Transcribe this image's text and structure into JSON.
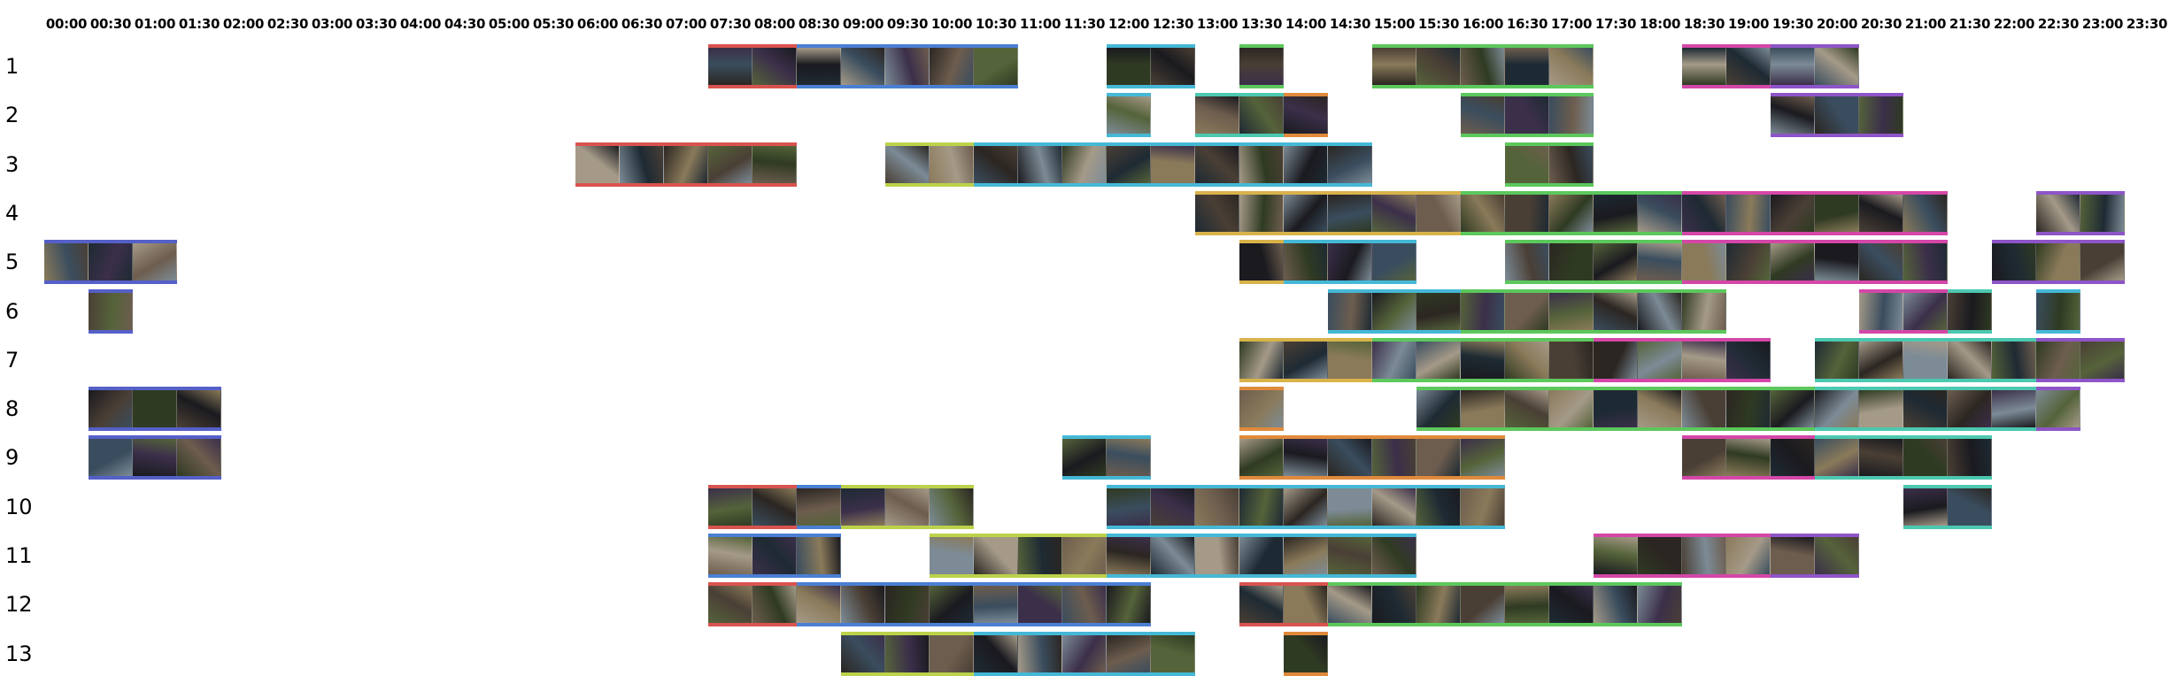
{
  "time_labels": [
    "00:00",
    "00:30",
    "01:00",
    "01:30",
    "02:00",
    "02:30",
    "03:00",
    "03:30",
    "04:00",
    "04:30",
    "05:00",
    "05:30",
    "06:00",
    "06:30",
    "07:00",
    "07:30",
    "08:00",
    "08:30",
    "09:00",
    "09:30",
    "10:00",
    "10:30",
    "11:00",
    "11:30",
    "12:00",
    "12:30",
    "13:00",
    "13:30",
    "14:00",
    "14:30",
    "15:00",
    "15:30",
    "16:00",
    "16:30",
    "17:00",
    "17:30",
    "18:00",
    "18:30",
    "19:00",
    "19:30",
    "20:00",
    "20:30",
    "21:00",
    "21:30",
    "22:00",
    "22:30",
    "23:00",
    "23:30"
  ],
  "bar_colors": {
    "red": "#d9534f",
    "blue": "#4a7fd4",
    "cyan": "#45b8d6",
    "green": "#5cc85c",
    "olive": "#bcd24a",
    "orange": "#e08a3c",
    "magenta": "#d447a8",
    "purple": "#8e55c8",
    "indigo": "#5560c8",
    "teal": "#4cc8b0",
    "gold": "#d8b34a"
  },
  "thumbnail_palette": [
    "#2b2622",
    "#4a3f35",
    "#6d5d4e",
    "#1e2a33",
    "#3a4d5e",
    "#7c8b96",
    "#2f3a22",
    "#55633a",
    "#8a7a5a",
    "#3b2f4a",
    "#a59a88",
    "#1a1a1f"
  ],
  "rows": [
    {
      "label": "1",
      "segments": [
        {
          "start": "07:30",
          "end": "08:30",
          "color": "red"
        },
        {
          "start": "08:30",
          "end": "11:00",
          "color": "blue"
        },
        {
          "start": "12:00",
          "end": "13:00",
          "color": "cyan"
        },
        {
          "start": "13:30",
          "end": "14:00",
          "color": "green"
        },
        {
          "start": "15:00",
          "end": "16:30",
          "color": "green"
        },
        {
          "start": "16:30",
          "end": "17:30",
          "color": "green"
        },
        {
          "start": "18:30",
          "end": "19:30",
          "color": "magenta"
        },
        {
          "start": "19:30",
          "end": "20:30",
          "color": "purple"
        }
      ]
    },
    {
      "label": "2",
      "segments": [
        {
          "start": "12:00",
          "end": "12:30",
          "color": "cyan"
        },
        {
          "start": "13:00",
          "end": "14:00",
          "color": "teal"
        },
        {
          "start": "14:00",
          "end": "14:30",
          "color": "orange"
        },
        {
          "start": "16:00",
          "end": "17:30",
          "color": "green"
        },
        {
          "start": "19:30",
          "end": "21:00",
          "color": "purple"
        }
      ]
    },
    {
      "label": "3",
      "segments": [
        {
          "start": "06:00",
          "end": "08:30",
          "color": "red"
        },
        {
          "start": "09:30",
          "end": "10:30",
          "color": "olive"
        },
        {
          "start": "10:30",
          "end": "15:00",
          "color": "cyan"
        },
        {
          "start": "16:30",
          "end": "17:30",
          "color": "green"
        }
      ]
    },
    {
      "label": "4",
      "segments": [
        {
          "start": "13:00",
          "end": "16:00",
          "color": "gold"
        },
        {
          "start": "16:00",
          "end": "18:30",
          "color": "green"
        },
        {
          "start": "18:30",
          "end": "21:30",
          "color": "magenta"
        },
        {
          "start": "22:30",
          "end": "23:30",
          "color": "purple"
        }
      ]
    },
    {
      "label": "5",
      "segments": [
        {
          "start": "00:00",
          "end": "01:30",
          "color": "indigo"
        },
        {
          "start": "13:30",
          "end": "14:00",
          "color": "gold"
        },
        {
          "start": "14:00",
          "end": "15:30",
          "color": "cyan"
        },
        {
          "start": "16:30",
          "end": "18:30",
          "color": "green"
        },
        {
          "start": "18:30",
          "end": "21:30",
          "color": "magenta"
        },
        {
          "start": "22:00",
          "end": "23:30",
          "color": "purple"
        }
      ]
    },
    {
      "label": "6",
      "segments": [
        {
          "start": "00:30",
          "end": "01:00",
          "color": "indigo"
        },
        {
          "start": "14:30",
          "end": "16:00",
          "color": "cyan"
        },
        {
          "start": "16:00",
          "end": "19:00",
          "color": "green"
        },
        {
          "start": "20:30",
          "end": "21:30",
          "color": "magenta"
        },
        {
          "start": "21:30",
          "end": "22:00",
          "color": "teal"
        },
        {
          "start": "22:30",
          "end": "23:00",
          "color": "cyan"
        }
      ]
    },
    {
      "label": "7",
      "segments": [
        {
          "start": "13:30",
          "end": "15:00",
          "color": "gold"
        },
        {
          "start": "15:00",
          "end": "17:30",
          "color": "green"
        },
        {
          "start": "17:30",
          "end": "19:30",
          "color": "magenta"
        },
        {
          "start": "20:00",
          "end": "22:30",
          "color": "teal"
        },
        {
          "start": "22:30",
          "end": "23:30",
          "color": "purple"
        }
      ]
    },
    {
      "label": "8",
      "segments": [
        {
          "start": "00:30",
          "end": "02:00",
          "color": "indigo"
        },
        {
          "start": "13:30",
          "end": "14:00",
          "color": "orange"
        },
        {
          "start": "15:30",
          "end": "17:00",
          "color": "green"
        },
        {
          "start": "17:00",
          "end": "20:00",
          "color": "green"
        },
        {
          "start": "20:00",
          "end": "21:30",
          "color": "teal"
        },
        {
          "start": "21:30",
          "end": "22:30",
          "color": "teal"
        },
        {
          "start": "22:30",
          "end": "23:00",
          "color": "purple"
        }
      ]
    },
    {
      "label": "9",
      "segments": [
        {
          "start": "00:30",
          "end": "02:00",
          "color": "indigo"
        },
        {
          "start": "11:30",
          "end": "12:30",
          "color": "cyan"
        },
        {
          "start": "13:30",
          "end": "16:30",
          "color": "orange"
        },
        {
          "start": "18:30",
          "end": "20:00",
          "color": "magenta"
        },
        {
          "start": "20:00",
          "end": "22:00",
          "color": "teal"
        }
      ]
    },
    {
      "label": "10",
      "segments": [
        {
          "start": "07:30",
          "end": "08:30",
          "color": "red"
        },
        {
          "start": "08:30",
          "end": "09:00",
          "color": "blue"
        },
        {
          "start": "09:00",
          "end": "10:30",
          "color": "olive"
        },
        {
          "start": "12:00",
          "end": "16:30",
          "color": "cyan"
        },
        {
          "start": "21:00",
          "end": "22:00",
          "color": "teal"
        }
      ]
    },
    {
      "label": "11",
      "segments": [
        {
          "start": "07:30",
          "end": "09:00",
          "color": "blue"
        },
        {
          "start": "10:00",
          "end": "12:00",
          "color": "olive"
        },
        {
          "start": "12:00",
          "end": "15:30",
          "color": "cyan"
        },
        {
          "start": "17:30",
          "end": "19:30",
          "color": "magenta"
        },
        {
          "start": "19:30",
          "end": "20:30",
          "color": "purple"
        }
      ]
    },
    {
      "label": "12",
      "segments": [
        {
          "start": "07:30",
          "end": "08:30",
          "color": "red"
        },
        {
          "start": "08:30",
          "end": "12:30",
          "color": "blue"
        },
        {
          "start": "13:30",
          "end": "14:30",
          "color": "red"
        },
        {
          "start": "14:30",
          "end": "18:30",
          "color": "green"
        }
      ]
    },
    {
      "label": "13",
      "segments": [
        {
          "start": "09:00",
          "end": "10:30",
          "color": "olive"
        },
        {
          "start": "10:30",
          "end": "13:00",
          "color": "cyan"
        },
        {
          "start": "14:00",
          "end": "14:30",
          "color": "orange"
        }
      ]
    }
  ]
}
